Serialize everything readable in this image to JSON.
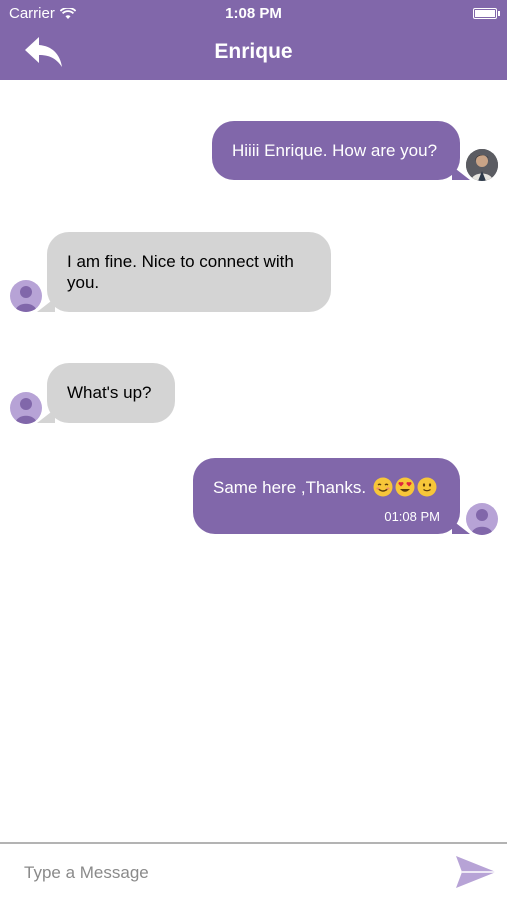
{
  "status_bar": {
    "carrier": "Carrier",
    "time": "1:08 PM"
  },
  "header": {
    "title": "Enrique",
    "back_icon": "reply-arrow-icon"
  },
  "messages": [
    {
      "direction": "outgoing",
      "text": "Hiiii Enrique. How are you?",
      "avatar": "photo"
    },
    {
      "direction": "incoming",
      "text": "I am fine. Nice to connect with you.",
      "avatar": "placeholder"
    },
    {
      "direction": "incoming",
      "text": "What's up?",
      "avatar": "placeholder"
    },
    {
      "direction": "outgoing",
      "text": "Same here ,Thanks.",
      "emojis": [
        "smiling-face",
        "heart-eyes-face",
        "slight-smile-face"
      ],
      "time": "01:08 PM",
      "avatar": "placeholder"
    }
  ],
  "composer": {
    "placeholder": "Type a Message",
    "value": "",
    "send_icon": "send-icon"
  },
  "colors": {
    "accent": "#8167aa",
    "incoming_bubble": "#d4d4d4",
    "avatar_placeholder": "#b7a3d6"
  }
}
